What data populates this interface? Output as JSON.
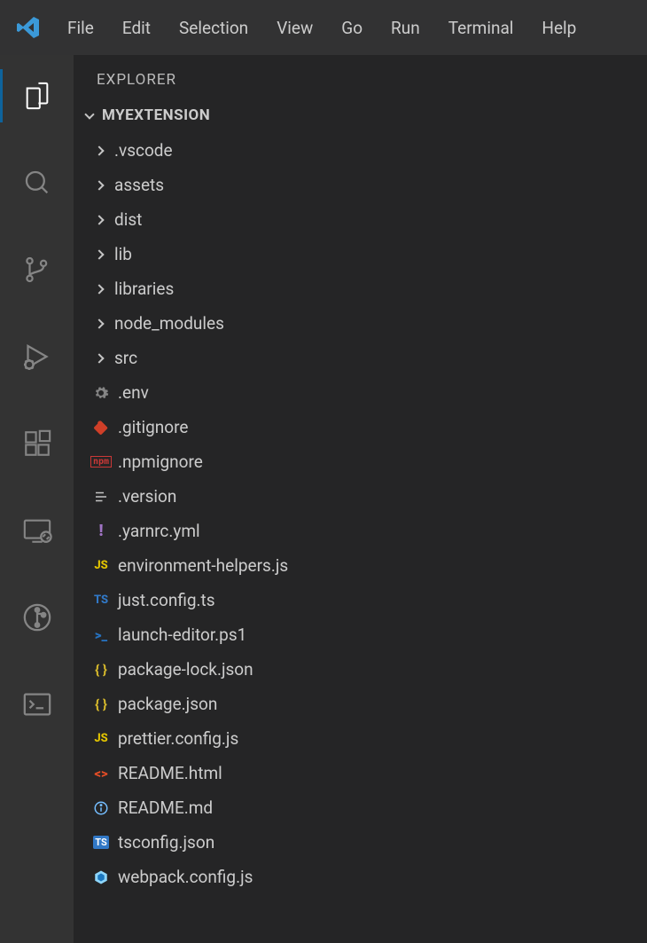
{
  "menu": {
    "file": "File",
    "edit": "Edit",
    "selection": "Selection",
    "view": "View",
    "go": "Go",
    "run": "Run",
    "terminal": "Terminal",
    "help": "Help"
  },
  "sidebar": {
    "title": "EXPLORER",
    "root": "MYEXTENSION"
  },
  "tree": {
    "folders": [
      ".vscode",
      "assets",
      "dist",
      "lib",
      "libraries",
      "node_modules",
      "src"
    ],
    "files": [
      {
        "name": ".env",
        "icon": "gear"
      },
      {
        "name": ".gitignore",
        "icon": "git"
      },
      {
        "name": ".npmignore",
        "icon": "npm"
      },
      {
        "name": ".version",
        "icon": "lines"
      },
      {
        "name": ".yarnrc.yml",
        "icon": "yaml"
      },
      {
        "name": "environment-helpers.js",
        "icon": "js"
      },
      {
        "name": "just.config.ts",
        "icon": "ts"
      },
      {
        "name": "launch-editor.ps1",
        "icon": "ps1"
      },
      {
        "name": "package-lock.json",
        "icon": "json"
      },
      {
        "name": "package.json",
        "icon": "json"
      },
      {
        "name": "prettier.config.js",
        "icon": "js"
      },
      {
        "name": "README.html",
        "icon": "html"
      },
      {
        "name": "README.md",
        "icon": "info"
      },
      {
        "name": "tsconfig.json",
        "icon": "tsbadge"
      },
      {
        "name": "webpack.config.js",
        "icon": "webpack"
      }
    ]
  }
}
